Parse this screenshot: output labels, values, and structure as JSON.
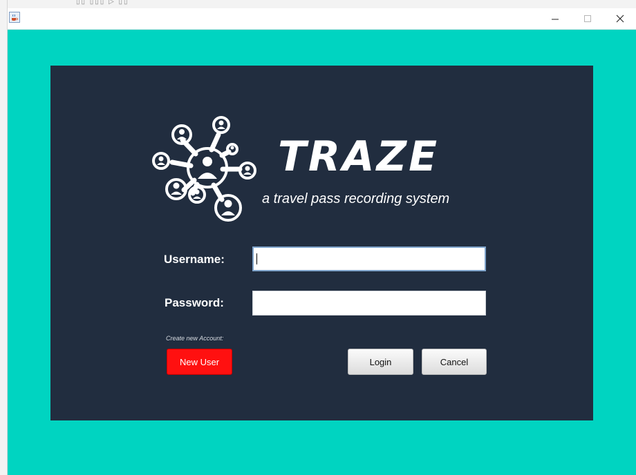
{
  "window": {
    "app_icon": "java-cup-icon",
    "controls": {
      "minimize": "–",
      "maximize": "□",
      "close": "✕"
    }
  },
  "brand": {
    "name": "TRAZE",
    "tagline": "a travel pass recording system",
    "logo_icon": "network-people-icon"
  },
  "form": {
    "username_label": "Username:",
    "username_value": "",
    "password_label": "Password:",
    "password_value": "",
    "hint": "Create new Account:"
  },
  "buttons": {
    "new_user": "New User",
    "login": "Login",
    "cancel": "Cancel"
  },
  "colors": {
    "window_bg": "#00d4c1",
    "panel_bg": "#212d3f",
    "new_user_button": "#ff1010"
  }
}
